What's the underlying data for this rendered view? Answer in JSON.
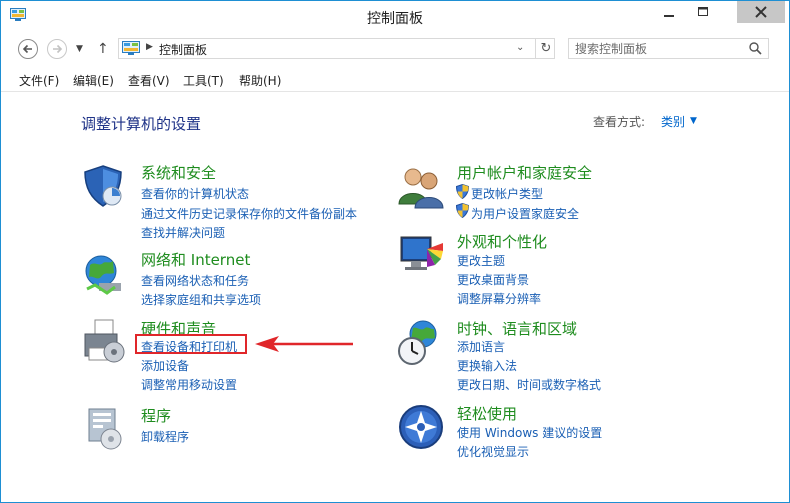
{
  "window": {
    "title": "控制面板"
  },
  "address": {
    "path": "控制面板",
    "search_placeholder": "搜索控制面板"
  },
  "menu": [
    "文件(F)",
    "编辑(E)",
    "查看(V)",
    "工具(T)",
    "帮助(H)"
  ],
  "heading": "调整计算机的设置",
  "view": {
    "label": "查看方式:",
    "value": "类别"
  },
  "categories": [
    {
      "title": "系统和安全",
      "icon": "shield-icon",
      "links": [
        "查看你的计算机状态",
        "通过文件历史记录保存你的文件备份副本",
        "查找并解决问题"
      ]
    },
    {
      "title": "网络和 Internet",
      "icon": "network-icon",
      "links": [
        "查看网络状态和任务",
        "选择家庭组和共享选项"
      ]
    },
    {
      "title": "硬件和声音",
      "icon": "printer-icon",
      "links": [
        "查看设备和打印机",
        "添加设备",
        "调整常用移动设置"
      ]
    },
    {
      "title": "程序",
      "icon": "programs-icon",
      "links": [
        "卸载程序"
      ]
    },
    {
      "title": "用户帐户和家庭安全",
      "icon": "users-icon",
      "links": [
        "更改帐户类型",
        "为用户设置家庭安全"
      ]
    },
    {
      "title": "外观和个性化",
      "icon": "display-icon",
      "links": [
        "更改主题",
        "更改桌面背景",
        "调整屏幕分辨率"
      ]
    },
    {
      "title": "时钟、语言和区域",
      "icon": "clock-globe-icon",
      "links": [
        "添加语言",
        "更换输入法",
        "更改日期、时间或数字格式"
      ]
    },
    {
      "title": "轻松使用",
      "icon": "ease-of-access-icon",
      "links": [
        "使用 Windows 建议的设置",
        "优化视觉显示"
      ]
    }
  ],
  "colors": {
    "accent": "#1e8fd3",
    "category_title": "#1e8c1e",
    "link": "#1a5fb4",
    "annotation": "#e0262a"
  }
}
